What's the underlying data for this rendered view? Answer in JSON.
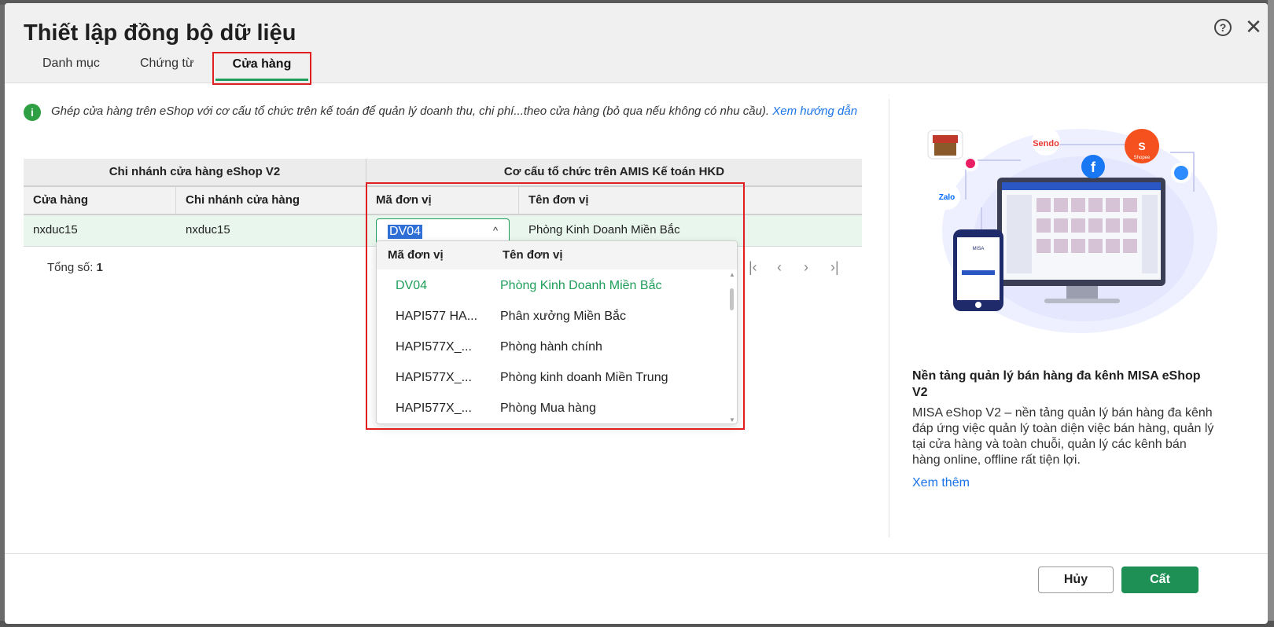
{
  "dialog": {
    "title": "Thiết lập đồng bộ dữ liệu",
    "help_glyph": "?",
    "close_glyph": "✕"
  },
  "tabs": [
    {
      "label": "Danh mục",
      "active": false
    },
    {
      "label": "Chứng từ",
      "active": false
    },
    {
      "label": "Cửa hàng",
      "active": true
    }
  ],
  "info": {
    "icon_glyph": "i",
    "text": "Ghép cửa hàng trên eShop với cơ cấu tổ chức trên kế toán để quản lý doanh thu, chi phí...theo cửa hàng (bỏ qua nếu không có nhu cầu). ",
    "link": "Xem hướng dẫn"
  },
  "grid": {
    "group_left": "Chi nhánh cửa hàng eShop V2",
    "group_right": "Cơ cấu tổ chức trên AMIS Kế toán HKD",
    "columns": [
      "Cửa hàng",
      "Chi nhánh cửa hàng",
      "Mã đơn vị",
      "Tên đơn vị"
    ],
    "rows": [
      {
        "store": "nxduc15",
        "branch": "nxduc15",
        "unit_code": "DV04",
        "unit_name": "Phòng Kinh Doanh Miền Bắc"
      }
    ],
    "chevron_glyph": "^"
  },
  "footer_total": {
    "label": "Tổng số: ",
    "value": "1"
  },
  "pager": {
    "first": "|‹",
    "prev": "‹",
    "next": "›",
    "last": "›|"
  },
  "dropdown": {
    "headers": [
      "Mã đơn vị",
      "Tên đơn vị"
    ],
    "options": [
      {
        "code": "DV04",
        "name": "Phòng Kinh Doanh Miền Bắc",
        "selected": true
      },
      {
        "code": "HAPI577 HA...",
        "name": "Phân xưởng Miền Bắc",
        "selected": false
      },
      {
        "code": "HAPI577X_...",
        "name": "Phòng hành chính",
        "selected": false
      },
      {
        "code": "HAPI577X_...",
        "name": "Phòng kinh doanh Miền Trung",
        "selected": false
      },
      {
        "code": "HAPI577X_...",
        "name": "Phòng Mua hàng",
        "selected": false
      }
    ]
  },
  "promo": {
    "illustration_labels": [
      "Sendo",
      "Shopee",
      "Zalo",
      "MISA"
    ],
    "title": "Nền tảng quản lý bán hàng đa kênh MISA eShop V2",
    "description": "MISA eShop V2 – nền tảng quản lý bán hàng đa kênh đáp ứng việc quản lý toàn diện việc bán hàng, quản lý tại cửa hàng và toàn chuỗi, quản lý các kênh bán hàng online, offline rất tiện lợi.",
    "link": "Xem thêm"
  },
  "buttons": {
    "cancel": "Hủy",
    "save": "Cất"
  },
  "colors": {
    "accent": "#1e8f55",
    "highlight": "#e02020",
    "link": "#1a73e8"
  }
}
